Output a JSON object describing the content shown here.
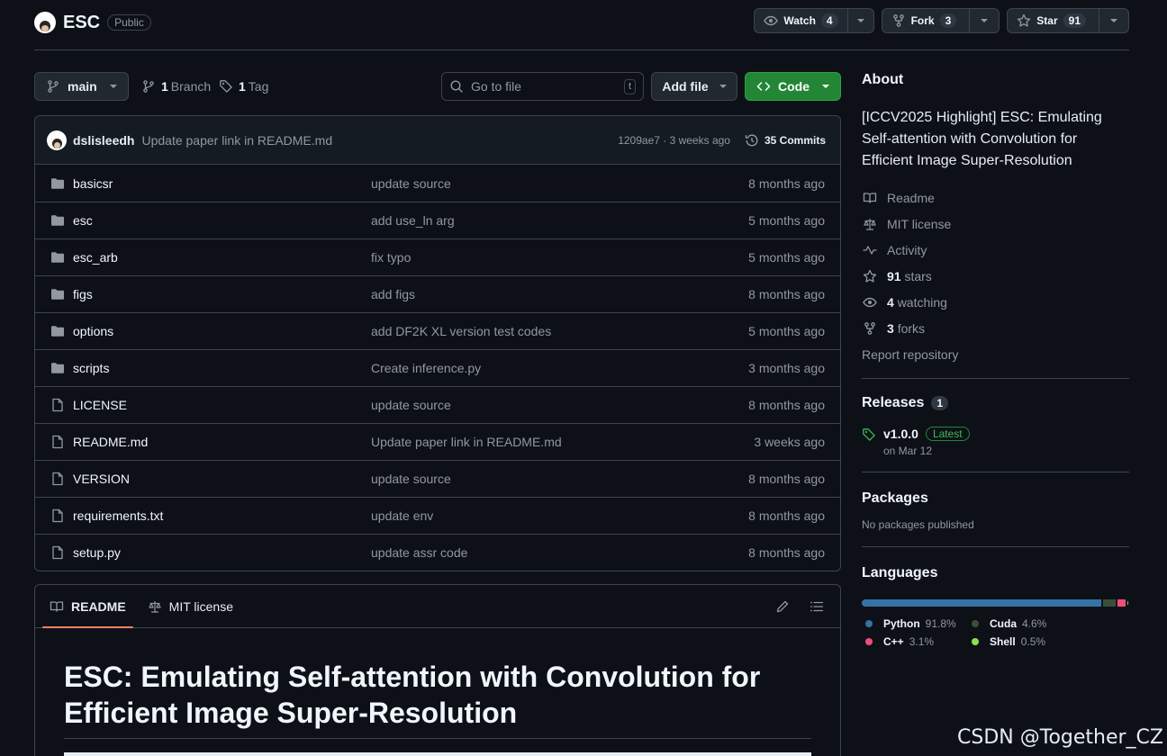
{
  "repo": {
    "name": "ESC",
    "visibility": "Public"
  },
  "header_actions": {
    "watch": {
      "label": "Watch",
      "count": "4"
    },
    "fork": {
      "label": "Fork",
      "count": "3"
    },
    "star": {
      "label": "Star",
      "count": "91"
    }
  },
  "toolbar": {
    "branch": "main",
    "branches_count": "1",
    "branches_label": "Branch",
    "tags_count": "1",
    "tags_label": "Tag",
    "search_placeholder": "Go to file",
    "search_shortcut": "t",
    "add_file": "Add file",
    "code": "Code"
  },
  "latest_commit": {
    "author": "dslisleedh",
    "message": "Update paper link in README.md",
    "meta": "1209ae7 · 3 weeks ago",
    "commits_label": "35 Commits"
  },
  "files": [
    {
      "type": "dir",
      "name": "basicsr",
      "message": "update source",
      "age": "8 months ago"
    },
    {
      "type": "dir",
      "name": "esc",
      "message": "add use_ln arg",
      "age": "5 months ago"
    },
    {
      "type": "dir",
      "name": "esc_arb",
      "message": "fix typo",
      "age": "5 months ago"
    },
    {
      "type": "dir",
      "name": "figs",
      "message": "add figs",
      "age": "8 months ago"
    },
    {
      "type": "dir",
      "name": "options",
      "message": "add DF2K XL version test codes",
      "age": "5 months ago"
    },
    {
      "type": "dir",
      "name": "scripts",
      "message": "Create inference.py",
      "age": "3 months ago"
    },
    {
      "type": "file",
      "name": "LICENSE",
      "message": "update source",
      "age": "8 months ago"
    },
    {
      "type": "file",
      "name": "README.md",
      "message": "Update paper link in README.md",
      "age": "3 weeks ago"
    },
    {
      "type": "file",
      "name": "VERSION",
      "message": "update source",
      "age": "8 months ago"
    },
    {
      "type": "file",
      "name": "requirements.txt",
      "message": "update env",
      "age": "8 months ago"
    },
    {
      "type": "file",
      "name": "setup.py",
      "message": "update assr code",
      "age": "8 months ago"
    }
  ],
  "readme": {
    "tab_readme": "README",
    "tab_license": "MIT license",
    "title": "ESC: Emulating Self-attention with Convolution for Efficient Image Super-Resolution"
  },
  "about": {
    "heading": "About",
    "description": "[ICCV2025 Highlight] ESC: Emulating Self-attention with Convolution for Efficient Image Super-Resolution",
    "readme": "Readme",
    "license": "MIT license",
    "activity": "Activity",
    "stars_count": "91",
    "stars_label": "stars",
    "watching_count": "4",
    "watching_label": "watching",
    "forks_count": "3",
    "forks_label": "forks",
    "report": "Report repository"
  },
  "releases": {
    "heading": "Releases",
    "count": "1",
    "tag": "v1.0.0",
    "badge": "Latest",
    "date": "on Mar 12"
  },
  "packages": {
    "heading": "Packages",
    "text": "No packages published"
  },
  "languages": {
    "heading": "Languages",
    "items": [
      {
        "name": "Python",
        "percent": "91.8%",
        "value": 91.8,
        "color": "#3572A5"
      },
      {
        "name": "Cuda",
        "percent": "4.6%",
        "value": 4.6,
        "color": "#3A4E3A"
      },
      {
        "name": "C++",
        "percent": "3.1%",
        "value": 3.1,
        "color": "#f34b7d"
      },
      {
        "name": "Shell",
        "percent": "0.5%",
        "value": 0.5,
        "color": "#89e051"
      }
    ]
  },
  "watermark": "CSDN @Together_CZ"
}
